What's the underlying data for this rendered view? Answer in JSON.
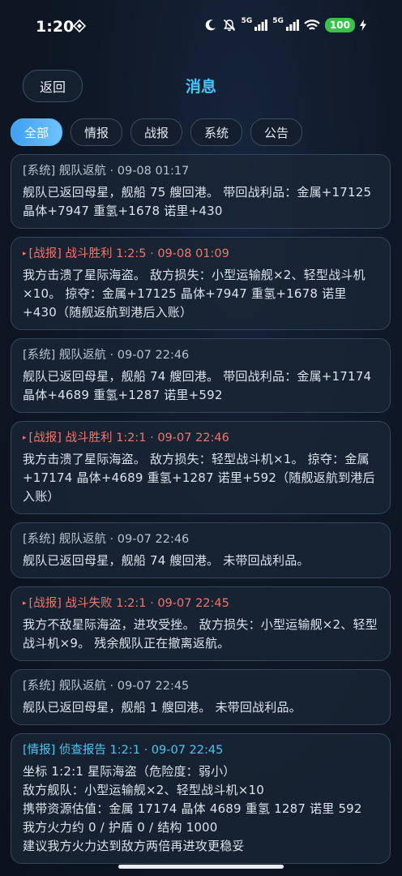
{
  "status_bar": {
    "time": "1:20",
    "net1": "5G",
    "net2": "5G",
    "battery": "100"
  },
  "header": {
    "back_label": "返回",
    "title": "消息"
  },
  "tabs": [
    "全部",
    "情报",
    "战报",
    "系统",
    "公告"
  ],
  "active_tab": "全部",
  "messages": [
    {
      "type": "system",
      "head": "[系统] 舰队返航 · 09-08 01:17",
      "body": "舰队已返回母星，舰船 75 艘回港。 带回战利品：金属+17125 晶体+7947 重氢+1678 诺里+430"
    },
    {
      "type": "battle",
      "head": "[战报] 战斗胜利 1:2:5 · 09-08 01:09",
      "body": "我方击溃了星际海盗。 敌方损失：小型运输舰×2、轻型战斗机×10。 掠夺：金属+17125 晶体+7947 重氢+1678 诺里+430（随舰返航到港后入账）"
    },
    {
      "type": "system",
      "head": "[系统] 舰队返航 · 09-07 22:46",
      "body": "舰队已返回母星，舰船 74 艘回港。 带回战利品：金属+17174 晶体+4689 重氢+1287 诺里+592"
    },
    {
      "type": "battle",
      "head": "[战报] 战斗胜利 1:2:1 · 09-07 22:46",
      "body": "我方击溃了星际海盗。 敌方损失：轻型战斗机×1。 掠夺：金属+17174 晶体+4689 重氢+1287 诺里+592（随舰返航到港后入账）"
    },
    {
      "type": "system",
      "head": "[系统] 舰队返航 · 09-07 22:46",
      "body": "舰队已返回母星，舰船 74 艘回港。 未带回战利品。"
    },
    {
      "type": "battle",
      "head": "[战报] 战斗失败 1:2:1 · 09-07 22:45",
      "body": "我方不敌星际海盗，进攻受挫。 敌方损失：小型运输舰×2、轻型战斗机×9。 残余舰队正在撤离返航。"
    },
    {
      "type": "system",
      "head": "[系统] 舰队返航 · 09-07 22:45",
      "body": "舰队已返回母星，舰船 1 艘回港。 未带回战利品。"
    },
    {
      "type": "intel",
      "head": "[情报] 侦查报告 1:2:1 · 09-07 22:45",
      "body_lines": [
        "坐标 1:2:1 星际海盗（危险度：弱小）",
        "敌方舰队：小型运输舰×2、轻型战斗机×10",
        "携带资源估值：金属 17174 晶体 4689 重氢 1287 诺里 592",
        "我方火力约 0 / 护盾 0 / 结构 1000",
        "建议我方火力达到敌方两倍再进攻更稳妥"
      ]
    }
  ],
  "colors": {
    "accent": "#49c4ff",
    "battle": "#f0766b",
    "intel": "#4fc6f2"
  }
}
